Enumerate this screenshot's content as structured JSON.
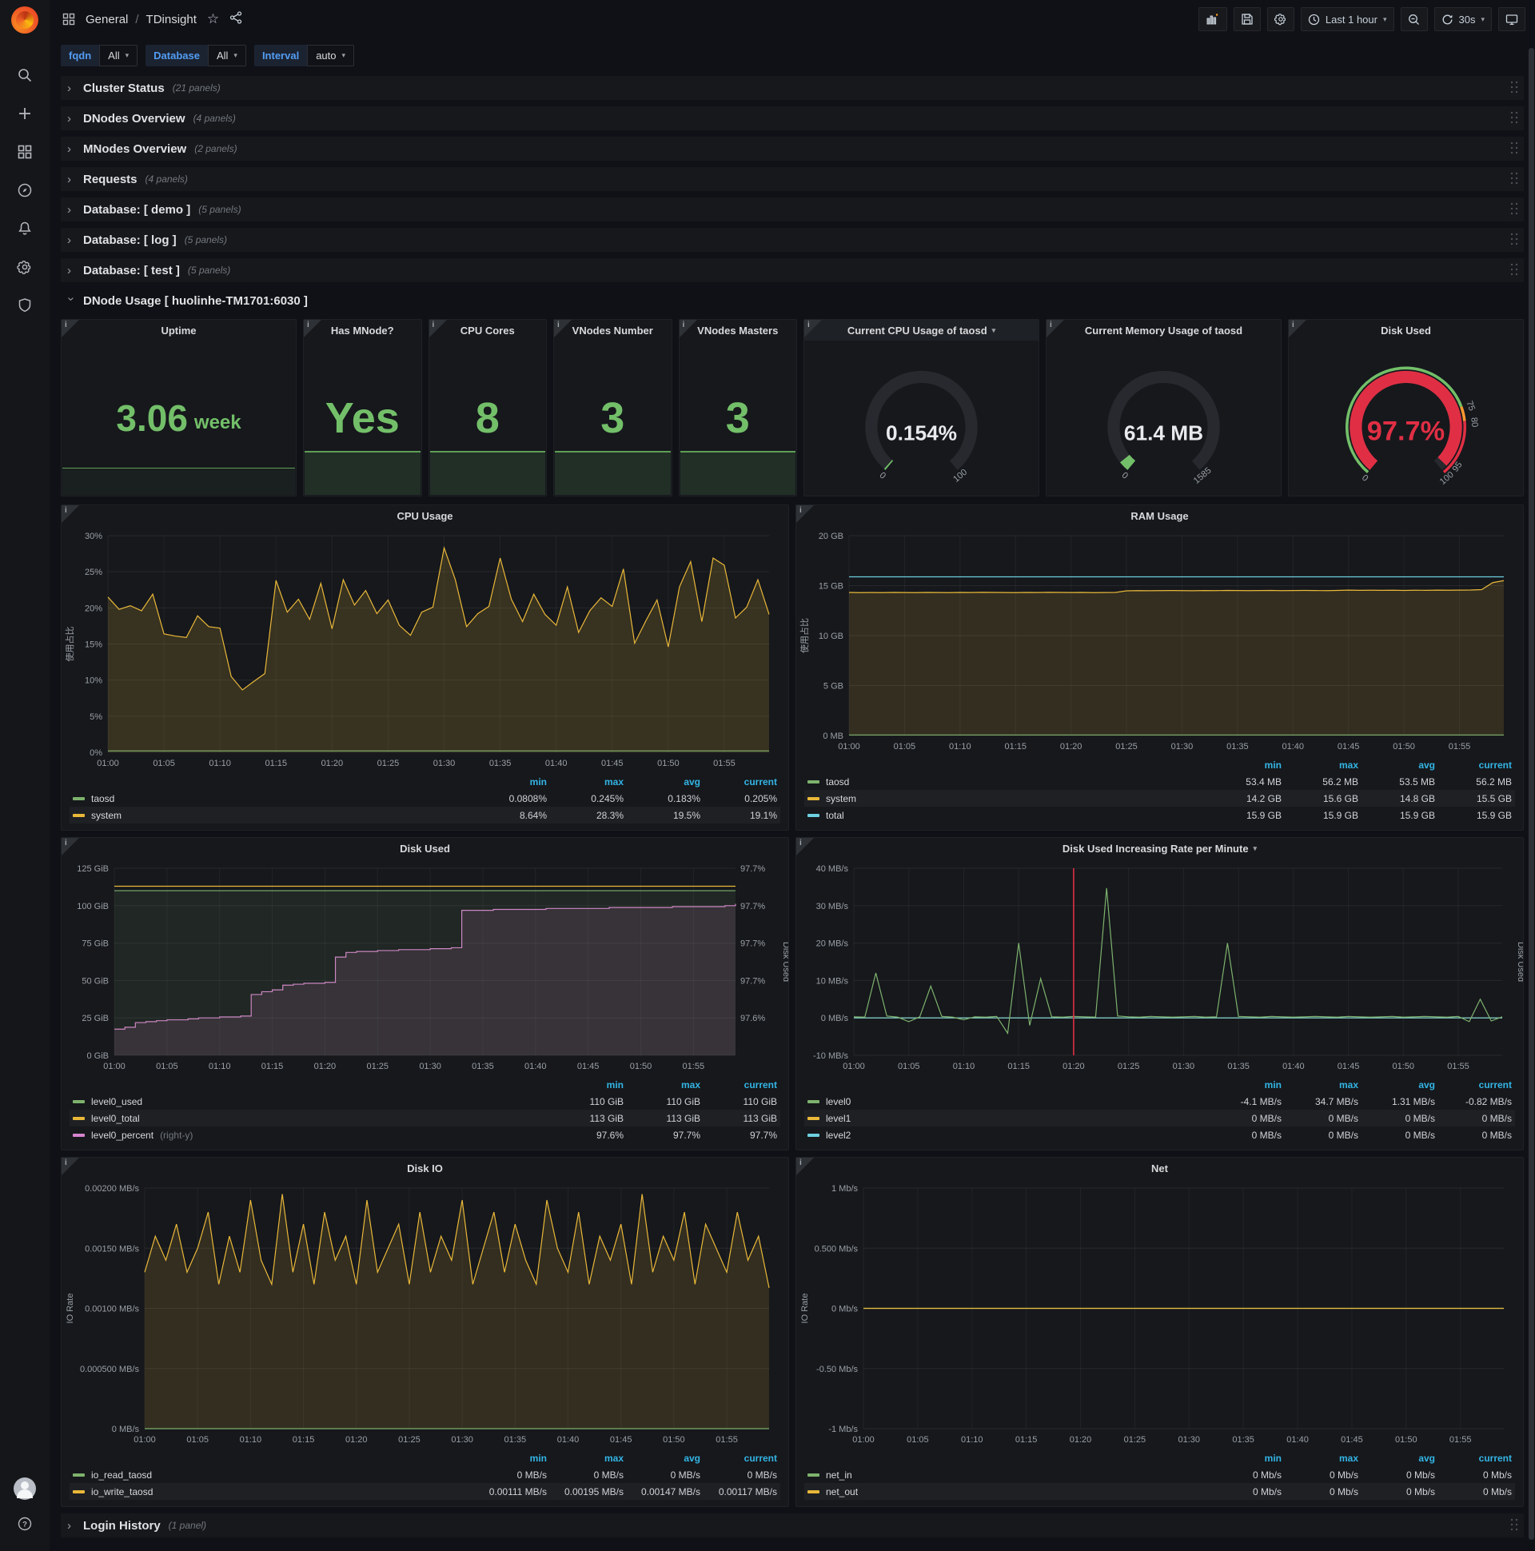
{
  "navbar": {
    "section": "General",
    "separator": "/",
    "title": "TDinsight",
    "time_range": "Last 1 hour",
    "refresh_interval": "30s"
  },
  "variables": [
    {
      "label": "fqdn",
      "value": "All"
    },
    {
      "label": "Database",
      "value": "All"
    },
    {
      "label": "Interval",
      "value": "auto"
    }
  ],
  "rows": [
    {
      "title": "Cluster Status",
      "count": "(21 panels)"
    },
    {
      "title": "DNodes Overview",
      "count": "(4 panels)"
    },
    {
      "title": "MNodes Overview",
      "count": "(2 panels)"
    },
    {
      "title": "Requests",
      "count": "(4 panels)"
    },
    {
      "title": "Database: [ demo ]",
      "count": "(5 panels)"
    },
    {
      "title": "Database: [ log ]",
      "count": "(5 panels)"
    },
    {
      "title": "Database: [ test ]",
      "count": "(5 panels)"
    }
  ],
  "expanded_row": {
    "title": "DNode Usage [ huolinhe-TM1701:6030 ]"
  },
  "login_row": {
    "title": "Login History",
    "count": "(1 panel)"
  },
  "colors": {
    "green": "#73bf69",
    "series_green": "#7eb26d",
    "series_yellow": "#eab839",
    "series_blue": "#6ed0e0",
    "series_pink": "#d683ce",
    "red": "#e02f44",
    "orange": "#ff9830"
  },
  "stats": [
    {
      "title": "Uptime",
      "value": "3.06",
      "unit": "week",
      "wide": true
    },
    {
      "title": "Has MNode?",
      "value": "Yes"
    },
    {
      "title": "CPU Cores",
      "value": "8"
    },
    {
      "title": "VNodes Number",
      "value": "3"
    },
    {
      "title": "VNodes Masters",
      "value": "3"
    }
  ],
  "gauges": [
    {
      "title": "Current CPU Usage of taosd",
      "dropdown": true,
      "value": "0.154%",
      "value_color": "#e8eaed",
      "pct": 0.004,
      "arc_color": "#73bf69",
      "ticks": [
        {
          "label": "0",
          "pct": 0
        },
        {
          "label": "100",
          "pct": 1
        }
      ],
      "ring": null
    },
    {
      "title": "Current Memory Usage of taosd",
      "dropdown": false,
      "value": "61.4 MB",
      "value_color": "#e8eaed",
      "pct": 0.039,
      "arc_color": "#73bf69",
      "ticks": [
        {
          "label": "0",
          "pct": 0
        },
        {
          "label": "1585",
          "pct": 1
        }
      ],
      "ring": null
    },
    {
      "title": "Disk Used",
      "dropdown": false,
      "value": "97.7%",
      "value_color": "#e02f44",
      "pct": 0.977,
      "arc_color": "#e02f44",
      "ticks": [
        {
          "label": "0",
          "pct": 0
        },
        {
          "label": "75",
          "pct": 0.75
        },
        {
          "label": "80",
          "pct": 0.8
        },
        {
          "label": "95",
          "pct": 0.95
        },
        {
          "label": "100",
          "pct": 1
        }
      ],
      "ring": [
        {
          "color": "#73bf69",
          "from": 0,
          "to": 0.75
        },
        {
          "color": "#ff9830",
          "from": 0.75,
          "to": 0.8
        },
        {
          "color": "#e02f44",
          "from": 0.8,
          "to": 1
        }
      ]
    }
  ],
  "time_ticks": [
    "01:00",
    "01:05",
    "01:10",
    "01:15",
    "01:20",
    "01:25",
    "01:30",
    "01:35",
    "01:40",
    "01:45",
    "01:50",
    "01:55"
  ],
  "chart_data": [
    {
      "id": "cpu",
      "type": "line",
      "title": "CPU Usage",
      "y_label": "使用占比",
      "ml": 58,
      "mr": 24,
      "y_min": 0,
      "y_max": 30,
      "y_tick_vals": [
        30,
        25,
        20,
        15,
        10,
        5,
        0
      ],
      "y_ticks": [
        "30%",
        "25%",
        "20%",
        "15%",
        "10%",
        "5%",
        "0%"
      ],
      "series": [
        {
          "name": "system",
          "color": "#eab839",
          "fill": 0.16,
          "values": [
            21.5,
            19.8,
            20.3,
            19.6,
            21.9,
            16.4,
            16.1,
            15.9,
            18.9,
            17.4,
            17.2,
            10.5,
            8.64,
            9.8,
            10.9,
            23.8,
            19.4,
            21.2,
            18.4,
            23.4,
            17.1,
            23.9,
            20.4,
            22.4,
            19.2,
            21.1,
            17.6,
            16.2,
            19.4,
            20.1,
            28.3,
            23.9,
            17.4,
            19.2,
            20.2,
            26.9,
            21.2,
            18.1,
            21.9,
            19.1,
            17.6,
            22.9,
            16.6,
            19.6,
            21.4,
            20.2,
            25.4,
            15.1,
            18.2,
            21.1,
            14.6,
            22.9,
            26.4,
            18.1,
            26.9,
            25.9,
            18.6,
            20.1,
            23.9,
            19.1
          ]
        },
        {
          "name": "taosd",
          "color": "#7eb26d",
          "flat": 0.2
        }
      ],
      "legend": {
        "headers": [
          "min",
          "max",
          "avg",
          "current"
        ],
        "rows": [
          {
            "name": "taosd",
            "color": "#7eb26d",
            "values": [
              "0.0808%",
              "0.245%",
              "0.183%",
              "0.205%"
            ]
          },
          {
            "name": "system",
            "color": "#eab839",
            "values": [
              "8.64%",
              "28.3%",
              "19.5%",
              "19.1%"
            ]
          }
        ]
      }
    },
    {
      "id": "ram",
      "type": "line",
      "title": "RAM Usage",
      "y_label": "使用占比",
      "ml": 66,
      "mr": 24,
      "y_min": 0,
      "y_max": 20,
      "y_tick_vals": [
        20,
        15,
        10,
        5,
        0
      ],
      "y_ticks": [
        "20 GB",
        "15 GB",
        "10 GB",
        "5 GB",
        "0 MB"
      ],
      "series": [
        {
          "name": "system",
          "color": "#eab839",
          "fill": 0.14,
          "values": [
            14.32,
            14.3,
            14.31,
            14.3,
            14.32,
            14.31,
            14.3,
            14.32,
            14.31,
            14.3,
            14.32,
            14.31,
            14.33,
            14.32,
            14.31,
            14.3,
            14.32,
            14.31,
            14.33,
            14.32,
            14.31,
            14.32,
            14.3,
            14.31,
            14.32,
            14.48,
            14.5,
            14.49,
            14.5,
            14.51,
            14.5,
            14.49,
            14.51,
            14.5,
            14.52,
            14.51,
            14.5,
            14.51,
            14.52,
            14.5,
            14.51,
            14.52,
            14.51,
            14.5,
            14.52,
            14.55,
            14.53,
            14.54,
            14.53,
            14.54,
            14.52,
            14.54,
            14.53,
            14.55,
            14.54,
            14.55,
            14.56,
            14.6,
            15.3,
            15.5
          ]
        },
        {
          "name": "total",
          "color": "#6ed0e0",
          "flat": 15.88
        },
        {
          "name": "taosd",
          "color": "#7eb26d",
          "flat": 0.055
        }
      ],
      "legend": {
        "headers": [
          "min",
          "max",
          "avg",
          "current"
        ],
        "rows": [
          {
            "name": "taosd",
            "color": "#7eb26d",
            "values": [
              "53.4 MB",
              "56.2 MB",
              "53.5 MB",
              "56.2 MB"
            ]
          },
          {
            "name": "system",
            "color": "#eab839",
            "values": [
              "14.2 GB",
              "15.6 GB",
              "14.8 GB",
              "15.5 GB"
            ]
          },
          {
            "name": "total",
            "color": "#6ed0e0",
            "values": [
              "15.9 GB",
              "15.9 GB",
              "15.9 GB",
              "15.9 GB"
            ]
          }
        ]
      }
    },
    {
      "id": "disk",
      "type": "line",
      "title": "Disk Used",
      "ml": 66,
      "mr": 66,
      "right_label": "Disk Used",
      "y_min": 0,
      "y_max": 125,
      "y_tick_vals": [
        125,
        100,
        75,
        50,
        25,
        0
      ],
      "y_ticks": [
        "125 GiB",
        "100 GiB",
        "75 GiB",
        "50 GiB",
        "25 GiB",
        "0 GiB"
      ],
      "right_min": 97.55,
      "right_max": 97.75,
      "right_tick_vals": [
        125,
        100,
        75,
        50,
        25
      ],
      "right_ticks": [
        "97.7%",
        "97.7%",
        "97.7%",
        "97.7%",
        "97.6%"
      ],
      "series": [
        {
          "name": "level0_percent",
          "color": "#d683ce",
          "axis": "right",
          "step": true,
          "fill": 0.13,
          "values": [
            97.578,
            97.58,
            97.585,
            97.586,
            97.587,
            97.588,
            97.588,
            97.589,
            97.59,
            97.59,
            97.591,
            97.591,
            97.592,
            97.615,
            97.618,
            97.62,
            97.625,
            97.626,
            97.627,
            97.627,
            97.628,
            97.655,
            97.66,
            97.661,
            97.661,
            97.662,
            97.662,
            97.663,
            97.663,
            97.663,
            97.664,
            97.664,
            97.665,
            97.705,
            97.705,
            97.705,
            97.706,
            97.706,
            97.706,
            97.706,
            97.706,
            97.707,
            97.707,
            97.707,
            97.707,
            97.707,
            97.707,
            97.708,
            97.708,
            97.708,
            97.708,
            97.708,
            97.708,
            97.709,
            97.709,
            97.709,
            97.709,
            97.709,
            97.71,
            97.712
          ]
        },
        {
          "name": "level0_used",
          "color": "#7eb26d",
          "flat": 110,
          "fill": 0.1
        },
        {
          "name": "level0_total",
          "color": "#eab839",
          "flat": 113
        }
      ],
      "legend": {
        "headers": [
          "min",
          "max",
          "current"
        ],
        "rows": [
          {
            "name": "level0_used",
            "color": "#7eb26d",
            "values": [
              "110 GiB",
              "110 GiB",
              "110 GiB"
            ]
          },
          {
            "name": "level0_total",
            "color": "#eab839",
            "values": [
              "113 GiB",
              "113 GiB",
              "113 GiB"
            ]
          },
          {
            "name": "level0_percent",
            "suffix": "(right-y)",
            "color": "#d683ce",
            "values": [
              "97.6%",
              "97.7%",
              "97.7%"
            ]
          }
        ]
      }
    },
    {
      "id": "rate",
      "type": "line",
      "title": "Disk Used Increasing Rate per Minute",
      "dropdown": true,
      "ml": 72,
      "mr": 26,
      "right_label": "Disk Used",
      "y_min": -10,
      "y_max": 40,
      "y_tick_vals": [
        40,
        30,
        20,
        10,
        0,
        -10
      ],
      "y_ticks": [
        "40 MB/s",
        "30 MB/s",
        "20 MB/s",
        "10 MB/s",
        "0 MB/s",
        "-10 MB/s"
      ],
      "annotation_min": 20,
      "series": [
        {
          "name": "level1",
          "color": "#eab839",
          "flat": 0
        },
        {
          "name": "level2",
          "color": "#6ed0e0",
          "flat": 0
        },
        {
          "name": "level0",
          "color": "#7eb26d",
          "values": [
            0.3,
            0.2,
            12,
            0.5,
            0.2,
            -1,
            0.3,
            8.5,
            0.4,
            0.2,
            -0.5,
            0.3,
            0.2,
            0.4,
            -4.1,
            20,
            -2,
            10.5,
            0.3,
            0.2,
            0.4,
            0.3,
            0.2,
            34.7,
            0.5,
            0.3,
            0.2,
            0.4,
            0.3,
            0.2,
            0.3,
            0.4,
            0.2,
            0.3,
            20,
            0.4,
            0.3,
            0.2,
            0.4,
            0.3,
            0.2,
            0.3,
            0.4,
            0.3,
            0.2,
            0.4,
            0.3,
            0.2,
            0.3,
            0.4,
            0.2,
            0.3,
            0.4,
            0.3,
            0.2,
            0.4,
            -1,
            5,
            -0.82,
            0.3
          ]
        }
      ],
      "legend": {
        "headers": [
          "min",
          "max",
          "avg",
          "current"
        ],
        "rows": [
          {
            "name": "level0",
            "color": "#7eb26d",
            "values": [
              "-4.1 MB/s",
              "34.7 MB/s",
              "1.31 MB/s",
              "-0.82 MB/s"
            ]
          },
          {
            "name": "level1",
            "color": "#eab839",
            "values": [
              "0 MB/s",
              "0 MB/s",
              "0 MB/s",
              "0 MB/s"
            ]
          },
          {
            "name": "level2",
            "color": "#6ed0e0",
            "values": [
              "0 MB/s",
              "0 MB/s",
              "0 MB/s",
              "0 MB/s"
            ]
          }
        ]
      }
    },
    {
      "id": "io",
      "type": "line",
      "title": "Disk IO",
      "y_label": "IO Rate",
      "ml": 104,
      "mr": 24,
      "y_min": 0,
      "y_max": 0.002,
      "y_tick_vals": [
        0.002,
        0.0015,
        0.001,
        0.0005,
        0
      ],
      "y_ticks": [
        "0.00200 MB/s",
        "0.00150 MB/s",
        "0.00100 MB/s",
        "0.000500 MB/s",
        "0 MB/s"
      ],
      "series": [
        {
          "name": "io_write_taosd",
          "color": "#eab839",
          "fill": 0.14,
          "values": [
            0.0013,
            0.0016,
            0.0014,
            0.0017,
            0.0013,
            0.0015,
            0.0018,
            0.0012,
            0.0016,
            0.0013,
            0.0019,
            0.0014,
            0.0012,
            0.00195,
            0.0013,
            0.0017,
            0.0012,
            0.0018,
            0.0014,
            0.0016,
            0.0012,
            0.0019,
            0.0013,
            0.0015,
            0.0017,
            0.0012,
            0.0018,
            0.0013,
            0.0016,
            0.0014,
            0.0019,
            0.0012,
            0.0015,
            0.0018,
            0.0013,
            0.0017,
            0.0014,
            0.0012,
            0.0019,
            0.0015,
            0.0013,
            0.0018,
            0.0012,
            0.0016,
            0.0014,
            0.0017,
            0.0012,
            0.00195,
            0.0013,
            0.0016,
            0.0014,
            0.0018,
            0.0012,
            0.0017,
            0.0015,
            0.0013,
            0.0018,
            0.0014,
            0.0016,
            0.00117
          ]
        },
        {
          "name": "io_read_taosd",
          "color": "#7eb26d",
          "flat": 0
        }
      ],
      "legend": {
        "headers": [
          "min",
          "max",
          "avg",
          "current"
        ],
        "rows": [
          {
            "name": "io_read_taosd",
            "color": "#7eb26d",
            "values": [
              "0 MB/s",
              "0 MB/s",
              "0 MB/s",
              "0 MB/s"
            ]
          },
          {
            "name": "io_write_taosd",
            "color": "#eab839",
            "values": [
              "0.00111 MB/s",
              "0.00195 MB/s",
              "0.00147 MB/s",
              "0.00117 MB/s"
            ]
          }
        ]
      }
    },
    {
      "id": "net",
      "type": "line",
      "title": "Net",
      "y_label": "IO Rate",
      "ml": 84,
      "mr": 24,
      "y_min": -1,
      "y_max": 1,
      "y_tick_vals": [
        1,
        0.5,
        0,
        -0.5,
        -1
      ],
      "y_ticks": [
        "1 Mb/s",
        "0.500 Mb/s",
        "0 Mb/s",
        "-0.50 Mb/s",
        "-1 Mb/s"
      ],
      "series": [
        {
          "name": "net_in",
          "color": "#7eb26d",
          "flat": 0
        },
        {
          "name": "net_out",
          "color": "#eab839",
          "flat": 0
        }
      ],
      "legend": {
        "headers": [
          "min",
          "max",
          "avg",
          "current"
        ],
        "rows": [
          {
            "name": "net_in",
            "color": "#7eb26d",
            "values": [
              "0 Mb/s",
              "0 Mb/s",
              "0 Mb/s",
              "0 Mb/s"
            ]
          },
          {
            "name": "net_out",
            "color": "#eab839",
            "values": [
              "0 Mb/s",
              "0 Mb/s",
              "0 Mb/s",
              "0 Mb/s"
            ]
          }
        ]
      }
    }
  ]
}
